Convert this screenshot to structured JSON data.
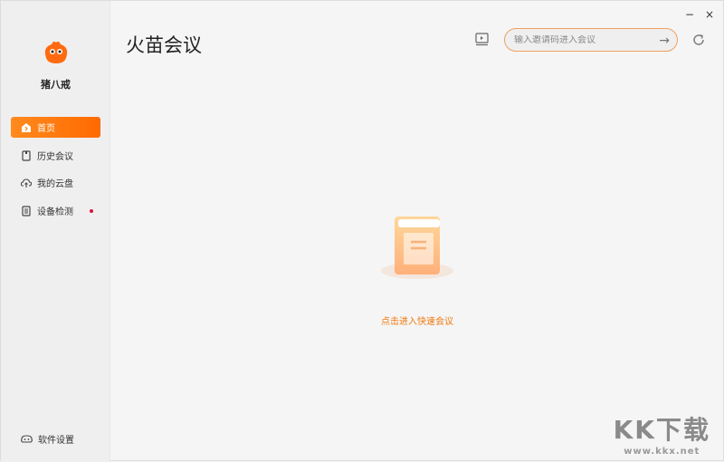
{
  "user": {
    "name": "猪八戒"
  },
  "sidebar": {
    "items": [
      {
        "label": "首页",
        "icon": "home-icon",
        "active": true
      },
      {
        "label": "历史会议",
        "icon": "history-icon"
      },
      {
        "label": "我的云盘",
        "icon": "cloud-upload-icon"
      },
      {
        "label": "设备检测",
        "icon": "device-check-icon",
        "badge": true
      }
    ],
    "settings_label": "软件设置"
  },
  "header": {
    "title": "火苗会议",
    "search_placeholder": "输入邀请码进入会议"
  },
  "window": {
    "minimize": "−",
    "close": "×"
  },
  "main": {
    "empty_action": "点击进入快速会议"
  },
  "watermark": {
    "title": "KK下载",
    "url": "www.kkx.net"
  },
  "colors": {
    "accent": "#ff7a10"
  }
}
